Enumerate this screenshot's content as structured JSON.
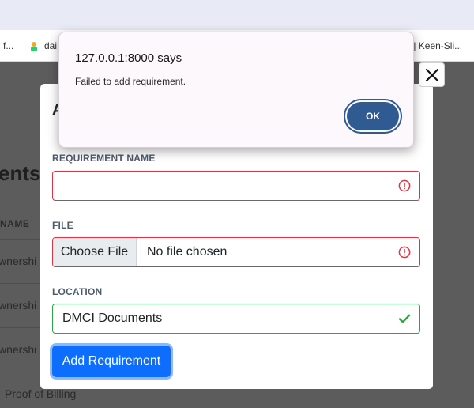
{
  "bookmarks": {
    "item1": "f...",
    "item2": "dai",
    "item3": "s | Keen-Sli..."
  },
  "background_page": {
    "heading": "ents",
    "column_header": "NAME",
    "rows": [
      "wnershi",
      "wnershi",
      "wnershi",
      "Proof of Billing"
    ]
  },
  "modal": {
    "title": "A",
    "requirement_label": "REQUIREMENT NAME",
    "requirement_value": "",
    "file_label": "FILE",
    "file_button": "Choose File",
    "file_status": "No file chosen",
    "location_label": "LOCATION",
    "location_value": "DMCI Documents",
    "submit_label": "Add Requirement"
  },
  "alert": {
    "origin": "127.0.0.1:8000 says",
    "message": "Failed to add requirement.",
    "ok_label": "OK"
  },
  "colors": {
    "invalid": "#dc3545",
    "valid": "#28a745",
    "primary": "#0d6efd",
    "ok_button": "#2f5a92"
  },
  "icons": {
    "error": "exclamation-circle-icon",
    "valid": "check-icon",
    "close": "close-icon"
  }
}
